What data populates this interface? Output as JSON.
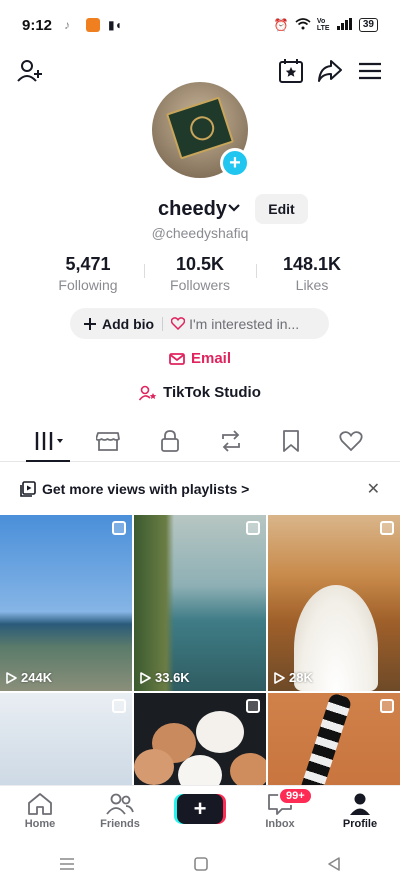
{
  "status_bar": {
    "time": "9:12",
    "battery": "39",
    "network_label": "Vo LTE"
  },
  "profile": {
    "username": "cheedy",
    "handle": "@cheedyshafiq",
    "edit_label": "Edit",
    "stats": [
      {
        "value": "5,471",
        "label": "Following"
      },
      {
        "value": "10.5K",
        "label": "Followers"
      },
      {
        "value": "148.1K",
        "label": "Likes"
      }
    ],
    "bio": {
      "add_label": "Add bio",
      "interest_label": "I'm interested in..."
    },
    "email_label": "Email",
    "studio_label": "TikTok Studio"
  },
  "promo": {
    "text": "Get more views with playlists >"
  },
  "videos": [
    {
      "views": "244K"
    },
    {
      "views": "33.6K"
    },
    {
      "views": "28K"
    },
    {
      "views": ""
    },
    {
      "views": ""
    },
    {
      "views": ""
    }
  ],
  "bottom_nav": {
    "home": "Home",
    "friends": "Friends",
    "inbox": "Inbox",
    "inbox_badge": "99+",
    "profile": "Profile"
  },
  "colors": {
    "accent_pink": "#fe2c55",
    "email_red": "#e0245e",
    "avatar_plus": "#20c5f0"
  }
}
